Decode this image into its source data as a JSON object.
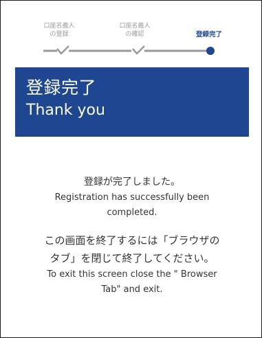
{
  "stepper": {
    "steps": [
      {
        "label_line1": "口座名義人",
        "label_line2": "の登録",
        "state": "done"
      },
      {
        "label_line1": "口座名義人",
        "label_line2": "の確認",
        "state": "done"
      },
      {
        "label_line1": "登録完了",
        "label_line2": "",
        "state": "current"
      }
    ],
    "done_icon": "checkmark-icon",
    "current_icon": "filled-circle-icon",
    "colors": {
      "done": "#9a9a9a",
      "current": "#1f4690"
    }
  },
  "banner": {
    "title": "登録完了",
    "subtitle": "Thank you",
    "background": "#1f4690"
  },
  "message": {
    "complete_jp": "登録が完了しました。",
    "complete_en_line1": "Registration has successfully been",
    "complete_en_line2": "completed.",
    "exit_jp_line1": "この画面を終了するには「ブラウザの",
    "exit_jp_line2": "タブ」を閉じて終了してください。",
    "exit_en_line1": "To exit this screen close the \" Browser",
    "exit_en_line2": "Tab\" and exit."
  }
}
